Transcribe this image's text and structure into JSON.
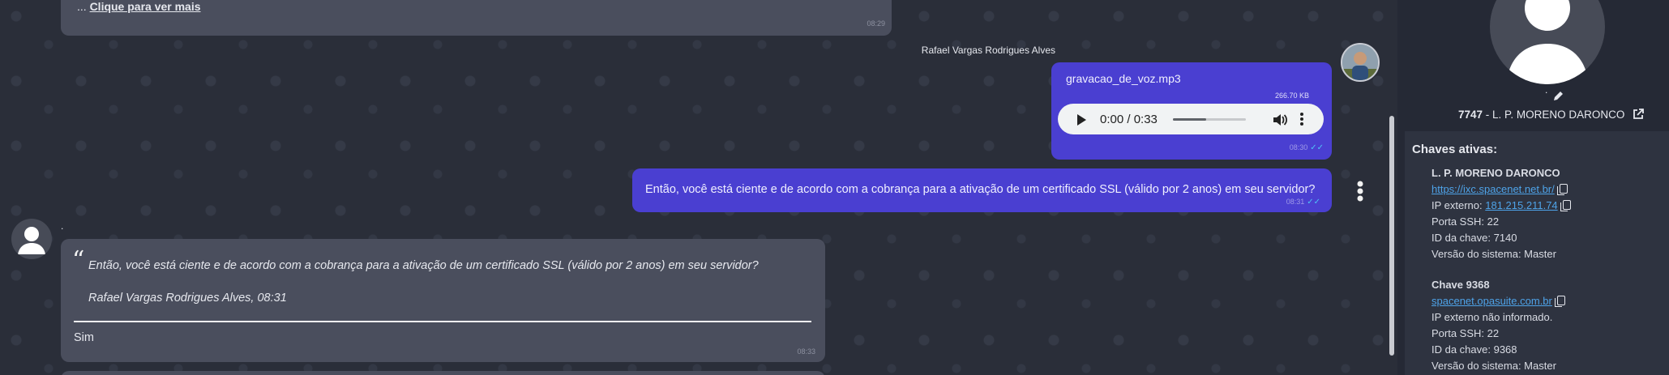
{
  "messages": {
    "top": {
      "prefix": "... ",
      "link": "Clique para ver mais",
      "time": "08:29"
    },
    "sender_name": "Rafael Vargas Rodrigues Alves",
    "audio": {
      "filename": "gravacao_de_voz.mp3",
      "size": "266.70 KB",
      "time_display": "0:00 / 0:33",
      "timestamp": "08:30",
      "progress": 0.45
    },
    "question": {
      "text": "Então, você está ciente e de acordo com a cobrança para a ativação de um certificado SSL (válido por 2 anos) em seu servidor?",
      "time": "08:31"
    },
    "reply_sender": ".",
    "reply": {
      "quote_text": "Então, você está ciente e de acordo com a cobrança para a ativação de um certificado SSL (válido por 2 anos) em seu servidor?",
      "quote_author": "Rafael Vargas Rodrigues Alves, 08:31",
      "answer": "Sim",
      "time": "08:33"
    }
  },
  "sidebar": {
    "profile_dot": ".",
    "client_id": "7747",
    "client_sep": " - ",
    "client_name": "L. P. MORENO DARONCO",
    "keys_title": "Chaves ativas:",
    "keys": [
      {
        "title": "L. P. MORENO DARONCO",
        "url": "https://ixc.spacenet.net.br/",
        "ip_label": "IP externo: ",
        "ip": "181.215.211.74",
        "ssh": "Porta SSH: 22",
        "key_id": "ID da chave: 7140",
        "version": "Versão do sistema: Master"
      },
      {
        "title": "Chave 9368",
        "url": "spacenet.opasuite.com.br",
        "ip_text": "IP externo não informado.",
        "ssh": "Porta SSH: 22",
        "key_id": "ID da chave: 9368",
        "version": "Versão do sistema: Master"
      }
    ]
  }
}
